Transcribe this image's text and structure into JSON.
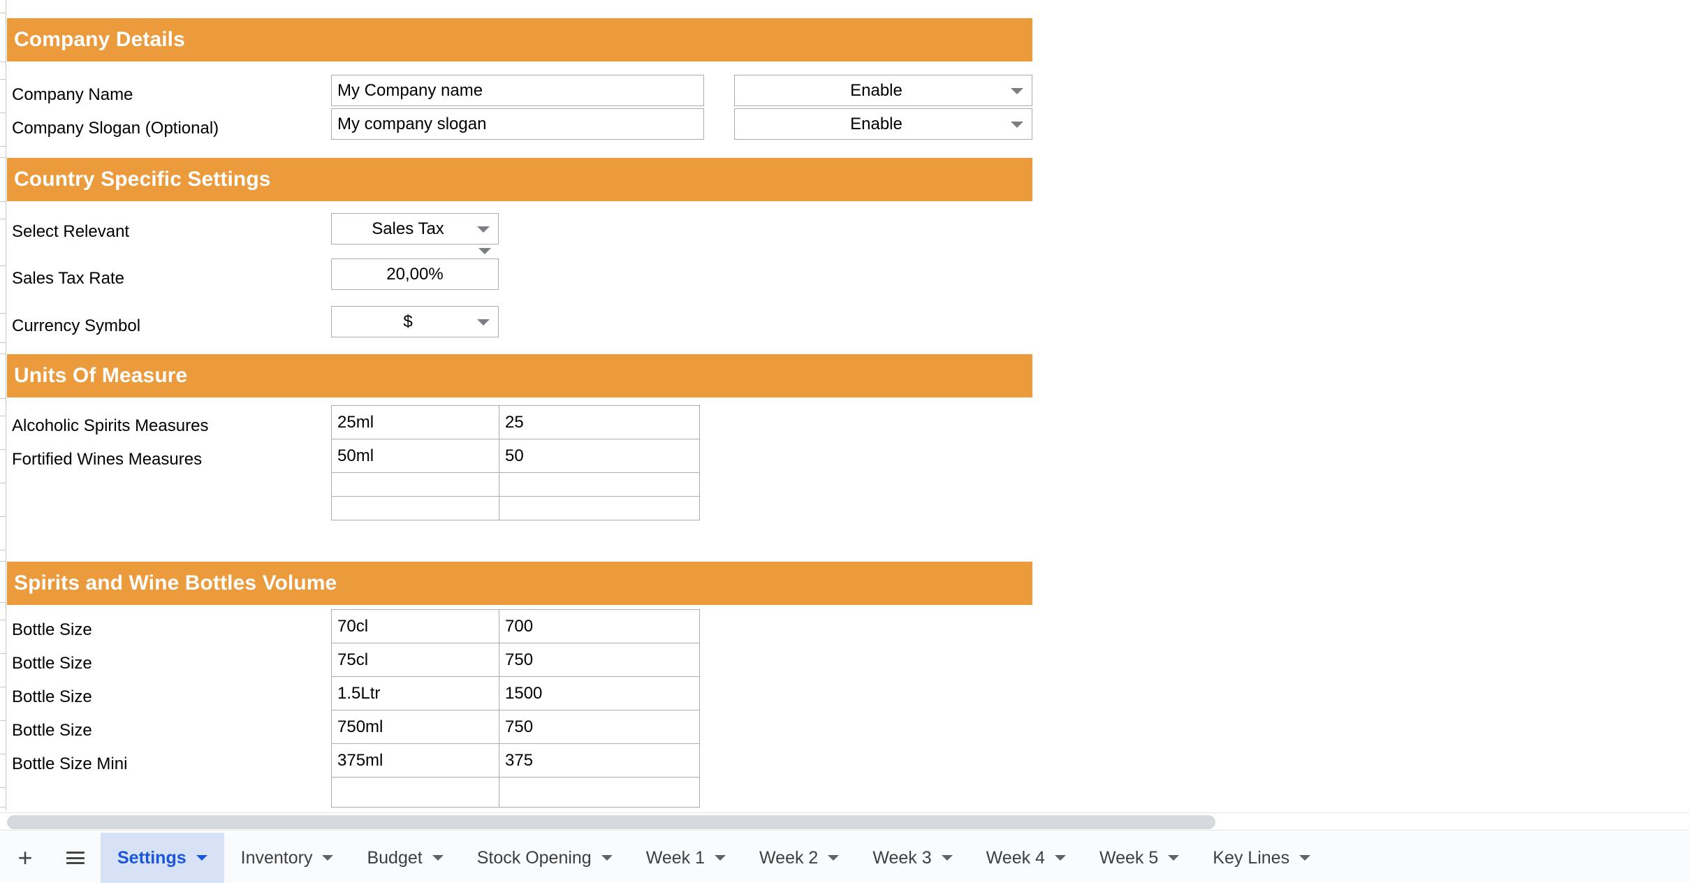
{
  "theme": {
    "section_band_color": "#eb9a3c",
    "band_text_color": "#ffffff",
    "active_tab_bg": "#d8e2f7",
    "active_tab_text": "#1a56db",
    "cell_border_color": "#a9adb0",
    "scrollbar_thumb_color": "#d6d9dd"
  },
  "sections": {
    "company_details": {
      "title": "Company Details",
      "rows": [
        {
          "label": "Company Name",
          "value": "My Company name",
          "toggle": "Enable"
        },
        {
          "label": "Company Slogan (Optional)",
          "value": "My company slogan",
          "toggle": "Enable"
        }
      ]
    },
    "country_specific_settings": {
      "title": "Country Specific Settings",
      "rows": [
        {
          "label": "Select Relevant",
          "value": "Sales Tax",
          "type": "dropdown"
        },
        {
          "label": "Sales Tax Rate",
          "value": "20,00%",
          "type": "number"
        },
        {
          "label": "Currency Symbol",
          "value": "$",
          "type": "dropdown"
        }
      ]
    },
    "units_of_measure": {
      "title": "Units Of Measure",
      "rows": [
        {
          "label": "Alcoholic Spirits Measures",
          "unit": "25ml",
          "amount": "25"
        },
        {
          "label": "Fortified Wines Measures",
          "unit": "50ml",
          "amount": "50"
        },
        {
          "label": "",
          "unit": "",
          "amount": ""
        },
        {
          "label": "",
          "unit": "",
          "amount": ""
        }
      ]
    },
    "spirits_and_wine_bottles_volume": {
      "title": "Spirits and Wine Bottles Volume",
      "rows": [
        {
          "label": "Bottle Size",
          "unit": "70cl",
          "amount": "700"
        },
        {
          "label": "Bottle Size",
          "unit": "75cl",
          "amount": "750"
        },
        {
          "label": "Bottle Size",
          "unit": "1.5Ltr",
          "amount": "1500"
        },
        {
          "label": "Bottle Size",
          "unit": "750ml",
          "amount": "750"
        },
        {
          "label": "Bottle Size Mini",
          "unit": "375ml",
          "amount": "375"
        },
        {
          "label": "",
          "unit": "",
          "amount": ""
        }
      ]
    }
  },
  "sheet_tabs": {
    "add_sheet_icon": "plus-icon",
    "all_sheets_icon": "hamburger-icon",
    "active": "Settings",
    "items": [
      {
        "label": "Settings",
        "active": true
      },
      {
        "label": "Inventory",
        "active": false
      },
      {
        "label": "Budget",
        "active": false
      },
      {
        "label": "Stock Opening",
        "active": false
      },
      {
        "label": "Week 1",
        "active": false
      },
      {
        "label": "Week 2",
        "active": false
      },
      {
        "label": "Week 3",
        "active": false
      },
      {
        "label": "Week 4",
        "active": false
      },
      {
        "label": "Week 5",
        "active": false
      },
      {
        "label": "Key Lines",
        "active": false
      }
    ]
  }
}
